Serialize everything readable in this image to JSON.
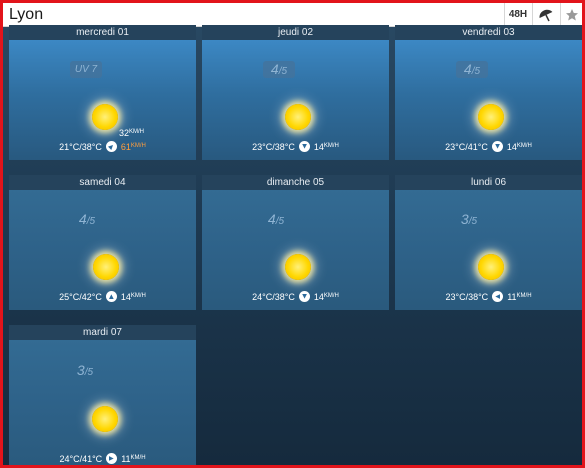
{
  "header": {
    "city": "Lyon",
    "period_button": "48H",
    "umbrella_icon": "umbrella-icon",
    "star_icon": "star-icon"
  },
  "days": [
    {
      "day": "mercredi 01",
      "rating": "UV 7",
      "rating_big": "",
      "rating_small": "",
      "temps": "21°C/38°C",
      "wind": "61",
      "wind_unit": "KM/H",
      "gust": "32",
      "gust_unit": "KM/H",
      "wind_direction": "north-east",
      "wind_color": "#ff9e3d"
    },
    {
      "day": "jeudi 02",
      "rating": "",
      "rating_big": "4",
      "rating_small": "/5",
      "temps": "23°C/38°C",
      "wind": "14",
      "wind_unit": "KM/H",
      "wind_direction": "south"
    },
    {
      "day": "vendredi 03",
      "rating": "",
      "rating_big": "4",
      "rating_small": "/5",
      "temps": "23°C/41°C",
      "wind": "14",
      "wind_unit": "KM/H",
      "wind_direction": "south"
    },
    {
      "day": "samedi 04",
      "rating": "",
      "rating_big": "4",
      "rating_small": "/5",
      "temps": "25°C/42°C",
      "wind": "14",
      "wind_unit": "KM/H",
      "wind_direction": "north"
    },
    {
      "day": "dimanche 05",
      "rating": "",
      "rating_big": "4",
      "rating_small": "/5",
      "temps": "24°C/38°C",
      "wind": "14",
      "wind_unit": "KM/H",
      "wind_direction": "south"
    },
    {
      "day": "lundi 06",
      "rating": "",
      "rating_big": "3",
      "rating_small": "/5",
      "temps": "23°C/38°C",
      "wind": "11",
      "wind_unit": "KM/H",
      "wind_direction": "west"
    },
    {
      "day": "mardi 07",
      "rating": "",
      "rating_big": "3",
      "rating_small": "/5",
      "temps": "24°C/41°C",
      "wind": "11",
      "wind_unit": "KM/H",
      "wind_direction": "east"
    }
  ],
  "colors": {
    "frame": "#e2141b",
    "background": "#1e3a52",
    "card_blue": "#3c88c4",
    "sun": "#ffd700"
  }
}
